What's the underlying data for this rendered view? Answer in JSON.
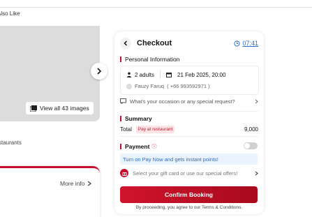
{
  "left": {
    "section_title": "Also Like",
    "view_all_label": "View all 43 images",
    "restaurants_label": "staurants",
    "more_info_label": "More info"
  },
  "checkout": {
    "title": "Checkout",
    "timer": "07:41",
    "personal_info_title": "Personal Information",
    "guests": "2 adults",
    "datetime": "21 Feb 2025, 20:00",
    "name": "Fauzy Faruq",
    "phone": "( +66 993592971 )",
    "occasion_prompt": "What's your occasion or any special request?",
    "summary_title": "Summary",
    "total_label": "Total",
    "pay_badge": "Pay at restaurant",
    "total_amount": "9,000",
    "payment_title": "Payment",
    "pay_now_text": "Turn on Pay Now and gets instant points!",
    "gift_text": "Select your gift card or use our special offers!",
    "confirm_label": "Confirm Booking",
    "terms_text": "By proceeding, you agree to our Terms & Conditions."
  },
  "colors": {
    "accent": "#c8102e",
    "link": "#2a6ac8"
  },
  "icons": [
    "chevron-right-icon",
    "gallery-icon",
    "back-arrow-icon",
    "clock-icon",
    "user-icon",
    "calendar-icon",
    "message-icon",
    "gift-icon",
    "info-icon"
  ]
}
